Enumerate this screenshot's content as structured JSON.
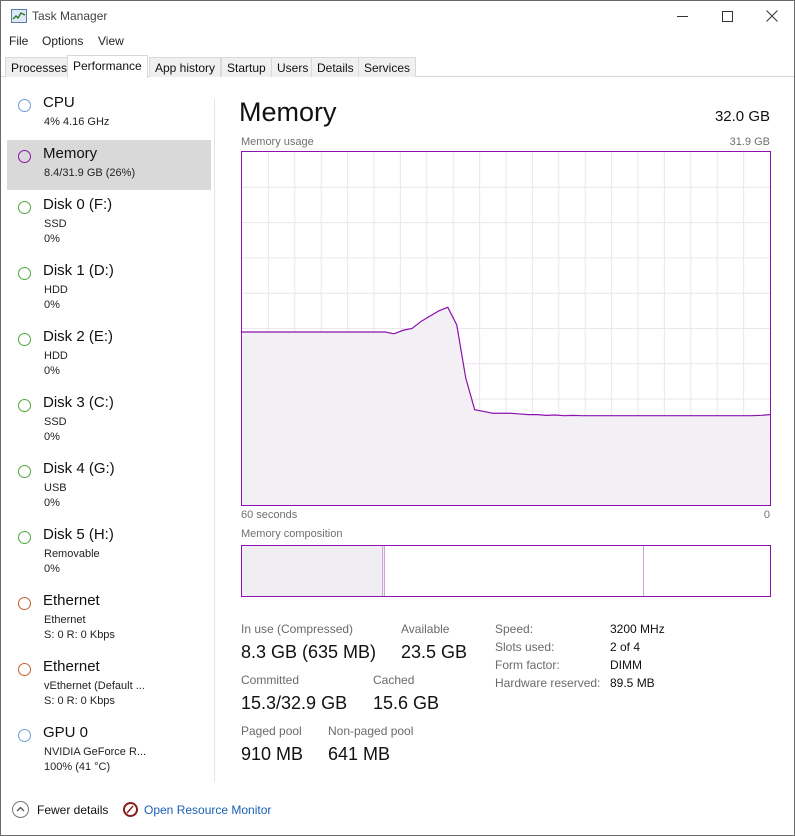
{
  "window": {
    "title": "Task Manager"
  },
  "menu": [
    "File",
    "Options",
    "View"
  ],
  "tabs": [
    "Processes",
    "Performance",
    "App history",
    "Startup",
    "Users",
    "Details",
    "Services"
  ],
  "active_tab": "Performance",
  "sidebar": [
    {
      "title": "CPU",
      "lines": [
        "4%  4.16 GHz"
      ],
      "color": "#6aa0d6"
    },
    {
      "title": "Memory",
      "lines": [
        "8.4/31.9 GB (26%)"
      ],
      "color": "#8b12ae"
    },
    {
      "title": "Disk 0 (F:)",
      "lines": [
        "SSD",
        "0%"
      ],
      "color": "#4ea83a"
    },
    {
      "title": "Disk 1 (D:)",
      "lines": [
        "HDD",
        "0%"
      ],
      "color": "#4ea83a"
    },
    {
      "title": "Disk 2 (E:)",
      "lines": [
        "HDD",
        "0%"
      ],
      "color": "#4ea83a"
    },
    {
      "title": "Disk 3 (C:)",
      "lines": [
        "SSD",
        "0%"
      ],
      "color": "#4ea83a"
    },
    {
      "title": "Disk 4 (G:)",
      "lines": [
        "USB",
        "0%"
      ],
      "color": "#4ea83a"
    },
    {
      "title": "Disk 5 (H:)",
      "lines": [
        "Removable",
        "0%"
      ],
      "color": "#4ea83a"
    },
    {
      "title": "Ethernet",
      "lines": [
        "Ethernet",
        "S: 0  R: 0 Kbps"
      ],
      "color": "#c8602a"
    },
    {
      "title": "Ethernet",
      "lines": [
        "vEthernet (Default ...",
        "S: 0  R: 0 Kbps"
      ],
      "color": "#c8602a"
    },
    {
      "title": "GPU 0",
      "lines": [
        "NVIDIA GeForce R...",
        "100%  (41 °C)"
      ],
      "color": "#6aa0d6"
    }
  ],
  "main": {
    "title": "Memory",
    "total": "32.0 GB",
    "usage_label": "Memory usage",
    "usage_max": "31.9 GB",
    "time_left": "60 seconds",
    "time_right": "0",
    "composition_label": "Memory composition",
    "accent_color": "#8b12ae",
    "fill_color": "#f1eef3"
  },
  "usage_history_pct": [
    49,
    49,
    49,
    49,
    49,
    49,
    49,
    49,
    49,
    49,
    49,
    49,
    49,
    49,
    49,
    49,
    49,
    48.5,
    49.5,
    50,
    52,
    53.5,
    55,
    56,
    51,
    36,
    27,
    26.5,
    26,
    26,
    26,
    25.8,
    25.6,
    25.6,
    25.4,
    25.5,
    25.3,
    25.4,
    25.3,
    25.3,
    25.3,
    25.3,
    25.3,
    25.3,
    25.3,
    25.3,
    25.3,
    25.3,
    25.3,
    25.3,
    25.3,
    25.3,
    25.3,
    25.3,
    25.3,
    25.3,
    25.3,
    25.3,
    25.4,
    25.6
  ],
  "composition": {
    "in_use_fraction": 0.265,
    "modified_fraction": 0.003,
    "standby_fraction": 0.49
  },
  "stats": {
    "in_use_label": "In use (Compressed)",
    "in_use_value": "8.3 GB (635 MB)",
    "available_label": "Available",
    "available_value": "23.5 GB",
    "committed_label": "Committed",
    "committed_value": "15.3/32.9 GB",
    "cached_label": "Cached",
    "cached_value": "15.6 GB",
    "paged_label": "Paged pool",
    "paged_value": "910 MB",
    "nonpaged_label": "Non-paged pool",
    "nonpaged_value": "641 MB"
  },
  "details": [
    {
      "label": "Speed:",
      "value": "3200 MHz"
    },
    {
      "label": "Slots used:",
      "value": "2 of 4"
    },
    {
      "label": "Form factor:",
      "value": "DIMM"
    },
    {
      "label": "Hardware reserved:",
      "value": "89.5 MB"
    }
  ],
  "footer": {
    "fewer_details": "Fewer details",
    "open_rm": "Open Resource Monitor"
  }
}
